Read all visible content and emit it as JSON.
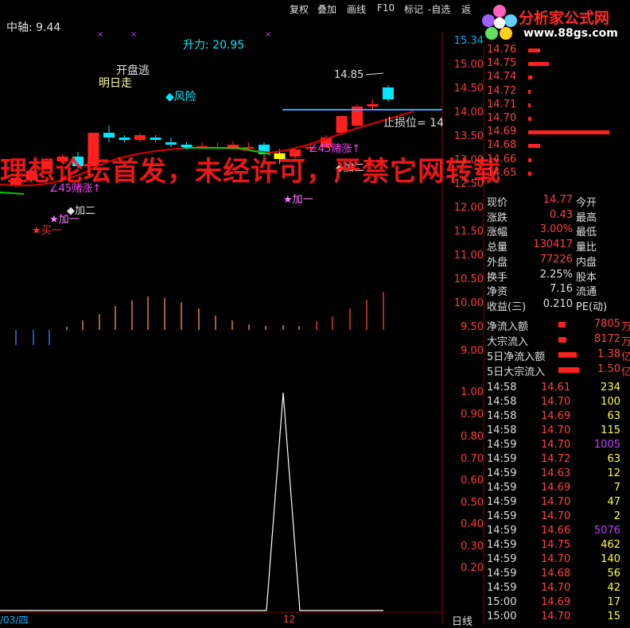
{
  "window": {
    "menu": [
      "复权",
      "叠加",
      "画线",
      "F10",
      "标记",
      "-自选",
      "返"
    ],
    "logo": {
      "title": "分析家公式网",
      "url": "www.88gs.com"
    },
    "period": "日线",
    "date_label": "/03/四"
  },
  "indicator_header": {
    "axis_label": "中轴: 9.44",
    "force_label": "升力: 20.95"
  },
  "annotations": {
    "open_escape": "开盘逃",
    "tomorrow_go": "明日走",
    "risk": "◆风险",
    "high_price": "14.85",
    "stop_loss": "止损位= 14",
    "bet_rise_1": "∠45赌涨↑",
    "bet_rise_2": "∠45赌涨↑",
    "add_one_1": "★加一",
    "add_two_1": "◆加二",
    "buy_one": "★买一",
    "add_two_2": "◆加二",
    "add_one_2": "★加一"
  },
  "watermark": "理想论坛首发，未经许可，严禁它网转载",
  "price_axis": [
    "15.34",
    "15.00",
    "14.50",
    "14.00",
    "13.50",
    "13.00",
    "12.50",
    "12.00",
    "11.50",
    "11.00",
    "10.50",
    "10.00",
    "9.50",
    "9.00"
  ],
  "osc_axis": [
    "1.00",
    "0.90",
    "0.80",
    "0.70",
    "0.60",
    "0.50",
    "0.40",
    "0.30",
    "0.20"
  ],
  "osc_label": "12",
  "order_book": [
    {
      "price": "14.76",
      "bar": 0.15
    },
    {
      "price": "14.75",
      "bar": 0.25
    },
    {
      "price": "14.74",
      "bar": 0.05
    },
    {
      "price": "14.72",
      "bar": 0.03
    },
    {
      "price": "14.71",
      "bar": 0.03
    },
    {
      "price": "14.70",
      "bar": 0.04
    },
    {
      "price": "14.69",
      "bar": 1.0
    },
    {
      "price": "14.68",
      "bar": 0.15
    },
    {
      "price": "14.66",
      "bar": 0.04
    },
    {
      "price": "14.65",
      "bar": 0.04
    }
  ],
  "quote": [
    {
      "label": "现价",
      "value": "14.77",
      "label2": "今开"
    },
    {
      "label": "涨跌",
      "value": "0.43",
      "label2": "最高"
    },
    {
      "label": "涨幅",
      "value": "3.00%",
      "label2": "最低"
    },
    {
      "label": "总量",
      "value": "130417",
      "label2": "量比"
    },
    {
      "label": "外盘",
      "value": "77226",
      "label2": "内盘"
    },
    {
      "label": "换手",
      "value": "2.25%",
      "label2": "股本"
    },
    {
      "label": "净资",
      "value": "7.16",
      "label2": "流通"
    },
    {
      "label": "收益(三)",
      "value": "0.210",
      "label2": "PE(动)"
    }
  ],
  "flows": [
    {
      "label": "净流入额",
      "value": "7805",
      "unit": "万",
      "bar": 0.35
    },
    {
      "label": "大宗流入",
      "value": "8172",
      "unit": "万",
      "bar": 0.37
    },
    {
      "label": "5日净流入额",
      "value": "1.38",
      "unit": "亿",
      "bar": 0.9
    },
    {
      "label": "5日大宗流入",
      "value": "1.50",
      "unit": "亿",
      "bar": 1.0
    }
  ],
  "ticks": [
    {
      "time": "14:58",
      "price": "14.61",
      "vol": "234"
    },
    {
      "time": "14:58",
      "price": "14.70",
      "vol": "100"
    },
    {
      "time": "14:58",
      "price": "14.69",
      "vol": "63"
    },
    {
      "time": "14:58",
      "price": "14.70",
      "vol": "115"
    },
    {
      "time": "14:59",
      "price": "14.70",
      "vol": "1005"
    },
    {
      "time": "14:59",
      "price": "14.72",
      "vol": "63"
    },
    {
      "time": "14:59",
      "price": "14.63",
      "vol": "12"
    },
    {
      "time": "14:59",
      "price": "14.69",
      "vol": "7"
    },
    {
      "time": "14:59",
      "price": "14.70",
      "vol": "47"
    },
    {
      "time": "14:59",
      "price": "14.70",
      "vol": "2"
    },
    {
      "time": "14:59",
      "price": "14.66",
      "vol": "5076"
    },
    {
      "time": "14:59",
      "price": "14.75",
      "vol": "462"
    },
    {
      "time": "14:59",
      "price": "14.70",
      "vol": "140"
    },
    {
      "time": "14:59",
      "price": "14.68",
      "vol": "56"
    },
    {
      "time": "14:59",
      "price": "14.70",
      "vol": "42"
    },
    {
      "time": "15:00",
      "price": "14.69",
      "vol": "17"
    },
    {
      "time": "15:00",
      "price": "14.70",
      "vol": "15"
    }
  ],
  "colors": {
    "up": "#ff2020",
    "down": "#00e8ff",
    "bg": "#000000",
    "ma": "#e00000",
    "stop": "#30a0ff"
  }
}
